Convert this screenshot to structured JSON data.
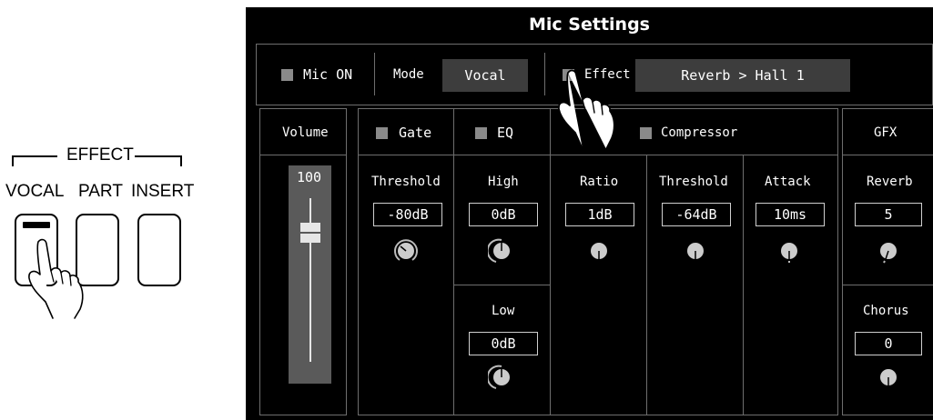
{
  "hardware": {
    "group_label": "EFFECT",
    "buttons": [
      "VOCAL",
      "PART",
      "INSERT"
    ]
  },
  "screen": {
    "title": "Mic Settings",
    "mic_on_label": "Mic ON",
    "mode_label": "Mode",
    "mode_value": "Vocal",
    "effect_label": "Effect",
    "effect_value": "Reverb > Hall 1",
    "volume": {
      "label": "Volume",
      "value": "100"
    },
    "gate": {
      "label": "Gate",
      "param": "Threshold",
      "value": "-80dB"
    },
    "eq": {
      "label": "EQ",
      "high_label": "High",
      "high_value": "0dB",
      "low_label": "Low",
      "low_value": "0dB"
    },
    "compressor": {
      "label": "Compressor",
      "ratio_label": "Ratio",
      "ratio_value": "1dB",
      "threshold_label": "Threshold",
      "threshold_value": "-64dB",
      "attack_label": "Attack",
      "attack_value": "10ms"
    },
    "gfx": {
      "label": "GFX",
      "reverb_label": "Reverb",
      "reverb_value": "5",
      "chorus_label": "Chorus",
      "chorus_value": "0"
    }
  },
  "colors": {
    "screen_bg": "#000000",
    "grid_line": "#6e6e6e",
    "checkbox": "#8a8a8a",
    "fader": "#5a5a5a"
  }
}
